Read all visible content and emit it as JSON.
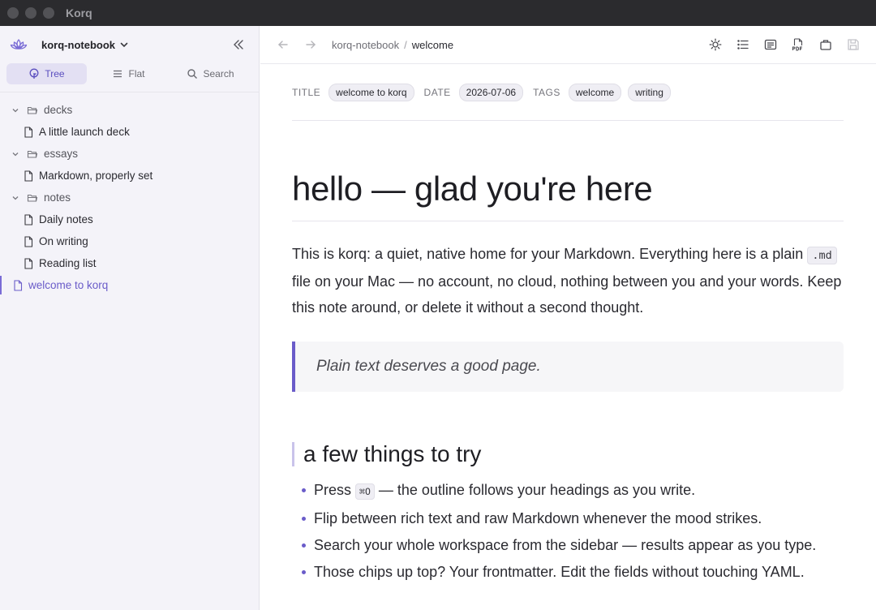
{
  "app": {
    "title": "Korq"
  },
  "sidebar": {
    "workspace": "korq-notebook",
    "tabs": [
      {
        "label": "Tree",
        "icon": "tree-icon",
        "active": true
      },
      {
        "label": "Flat",
        "icon": "list-icon",
        "active": false
      },
      {
        "label": "Search",
        "icon": "search-icon",
        "active": false
      }
    ],
    "tree": [
      {
        "type": "folder",
        "label": "decks"
      },
      {
        "type": "file",
        "label": "A little launch deck"
      },
      {
        "type": "folder",
        "label": "essays"
      },
      {
        "type": "file",
        "label": "Markdown, properly set"
      },
      {
        "type": "folder",
        "label": "notes"
      },
      {
        "type": "file",
        "label": "Daily notes"
      },
      {
        "type": "file",
        "label": "On writing"
      },
      {
        "type": "file",
        "label": "Reading list"
      },
      {
        "type": "file",
        "label": "welcome to korq",
        "active": true
      }
    ]
  },
  "toolbar": {
    "breadcrumb": [
      "korq-notebook",
      "welcome"
    ],
    "separator": "/"
  },
  "frontmatter": {
    "title_key": "TITLE",
    "title_value": "welcome to korq",
    "date_key": "DATE",
    "date_value": "2026-07-06",
    "tags_key": "TAGS",
    "tags": [
      "welcome",
      "writing"
    ]
  },
  "document": {
    "heading": "hello — glad you're here",
    "intro_before": "This is korq: a quiet, native home for your Markdown. Everything here is a plain ",
    "intro_code": ".md",
    "intro_after": " file on your Mac — no account, no cloud, nothing between you and your words. Keep this note around, or delete it without a second thought.",
    "quote": "Plain text deserves a good page.",
    "section_heading": "a few things to try",
    "item1_before": "Press ",
    "item1_kbd": "⌘O",
    "item1_after": " — the outline follows your headings as you write.",
    "item2": "Flip between rich text and raw Markdown whenever the mood strikes.",
    "item3": "Search your whole workspace from the sidebar — results appear as you type.",
    "item4": "Those chips up top? Your frontmatter. Edit the fields without touching YAML."
  },
  "colors": {
    "accent": "#6a5cc9",
    "titlebar": "#2b2b2e",
    "sidebar": "#f4f3f9"
  }
}
